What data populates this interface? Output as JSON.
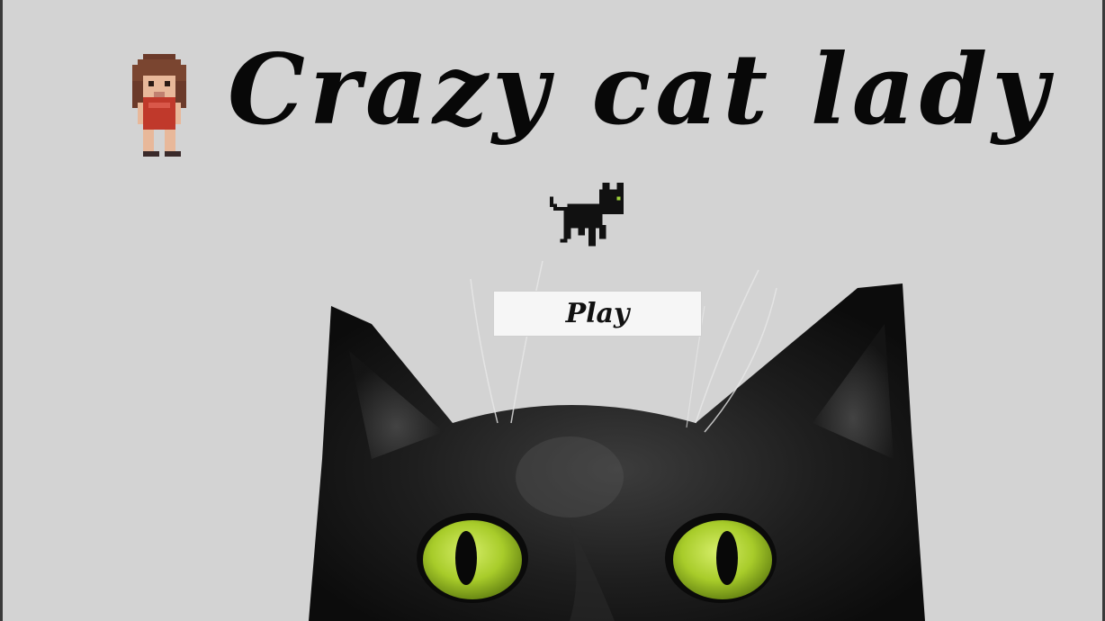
{
  "game": {
    "title": "Crazy cat lady",
    "play_label": "Play"
  },
  "colors": {
    "background": "#d3d3d3",
    "title": "#080808",
    "button_bg": "#f6f6f6",
    "cat_fur": "#1a1a1a",
    "cat_eye": "#a8d02a"
  },
  "icons": {
    "player_sprite": "cat-lady-sprite-icon",
    "cat_sprite": "black-cat-sprite-icon",
    "hero_image": "black-cat-photo"
  }
}
